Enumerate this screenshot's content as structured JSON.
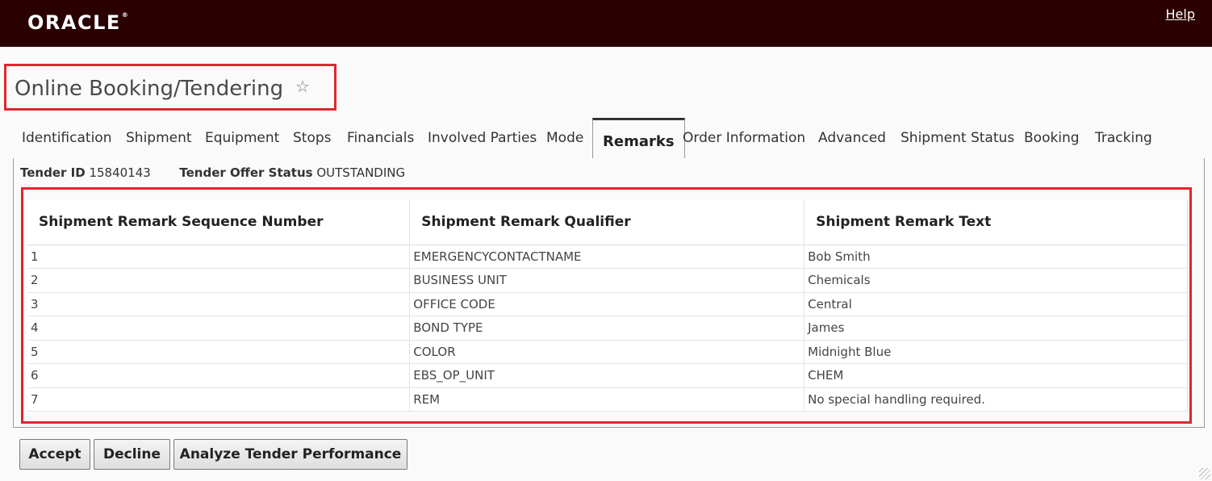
{
  "header": {
    "logo": "ORACLE",
    "logo_mark": "®",
    "help": "Help"
  },
  "page": {
    "title": "Online Booking/Tendering",
    "favorite_icon": "star-icon"
  },
  "tabs": [
    "Identification",
    "Shipment",
    "Equipment",
    "Stops",
    "Financials",
    "Involved Parties",
    "Mode",
    "Remarks",
    "Order Information",
    "Advanced",
    "Shipment Status",
    "Booking",
    "Tracking"
  ],
  "active_tab": "Remarks",
  "tender": {
    "id_label": "Tender ID",
    "id_value": "15840143",
    "status_label": "Tender Offer Status",
    "status_value": "OUTSTANDING"
  },
  "table": {
    "headers": [
      "Shipment Remark Sequence Number",
      "Shipment Remark Qualifier",
      "Shipment Remark Text"
    ],
    "rows": [
      [
        "1",
        "EMERGENCYCONTACTNAME",
        "Bob Smith"
      ],
      [
        "2",
        "BUSINESS UNIT",
        "Chemicals"
      ],
      [
        "3",
        "OFFICE CODE",
        "Central"
      ],
      [
        "4",
        "BOND TYPE",
        "James"
      ],
      [
        "5",
        "COLOR",
        "Midnight Blue"
      ],
      [
        "6",
        "EBS_OP_UNIT",
        "CHEM"
      ],
      [
        "7",
        "REM",
        "No special handling required."
      ]
    ]
  },
  "buttons": {
    "accept": "Accept",
    "decline": "Decline",
    "analyze": "Analyze Tender Performance"
  },
  "colors": {
    "header_bg": "#2a0000",
    "highlight": "#e0262e"
  }
}
